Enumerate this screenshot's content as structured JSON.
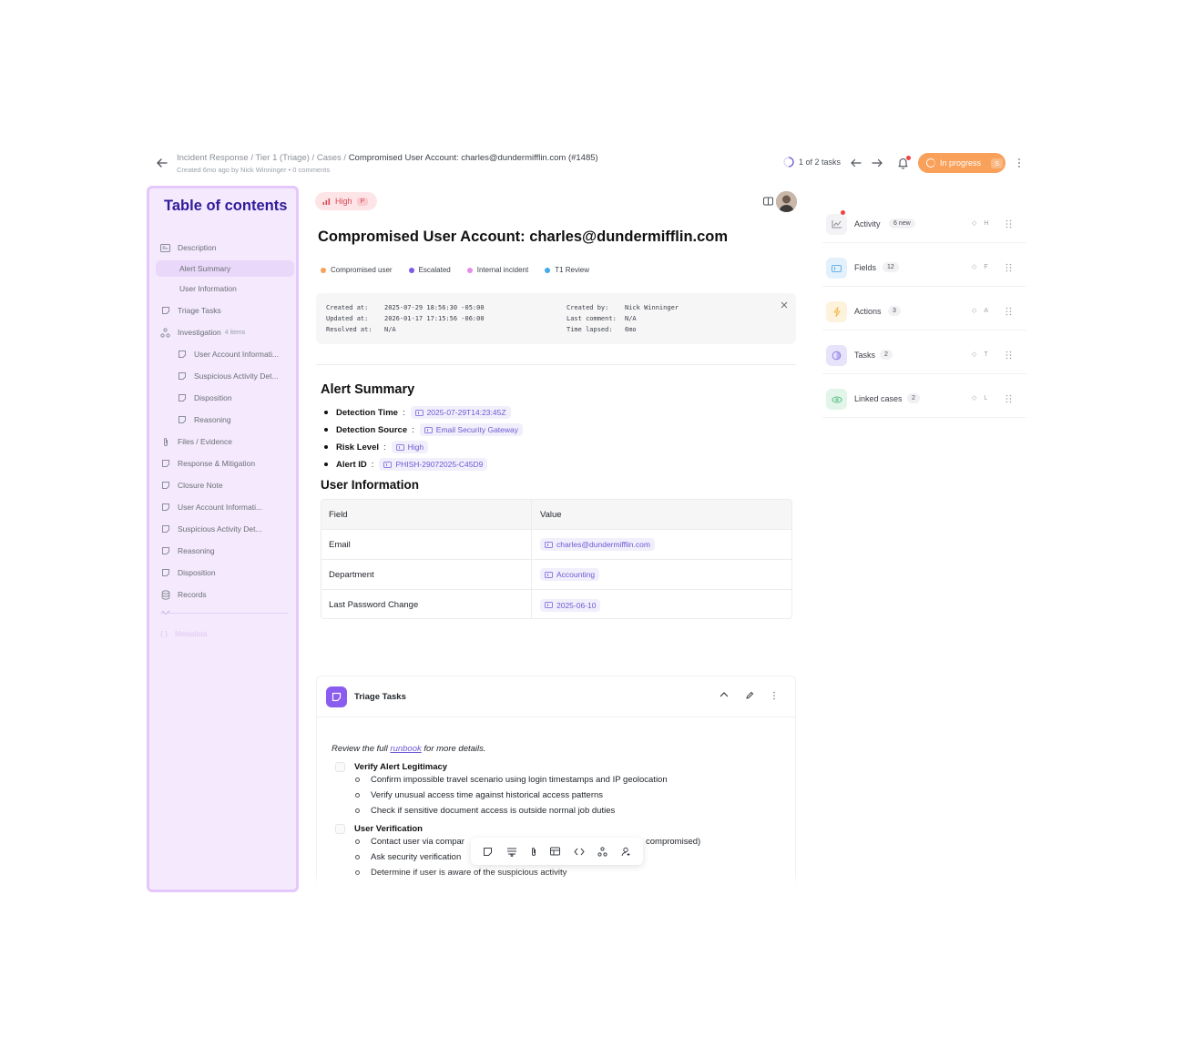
{
  "header": {
    "breadcrumb_path": "Incident Response / Tier 1 (Triage) / Cases / ",
    "breadcrumb_current": "Compromised User Account: charles@dundermifflin.com (#1485)",
    "subline": "Created 6mo ago by Nick Winninger • 0 comments",
    "task_progress": "1 of 2 tasks",
    "status_label": "In progress",
    "status_key": "S"
  },
  "toc": {
    "title": "Table of contents",
    "items": [
      {
        "label": "Description",
        "icon": "description-icon"
      },
      {
        "label": "Alert Summary"
      },
      {
        "label": "User Information"
      },
      {
        "label": "Triage Tasks",
        "icon": "note-icon"
      },
      {
        "label": "Investigation",
        "count": "4 items",
        "icon": "workflow-icon"
      },
      {
        "label": "User Account Informati...",
        "icon": "note-icon"
      },
      {
        "label": "Suspicious Activity Det...",
        "icon": "note-icon"
      },
      {
        "label": "Disposition",
        "icon": "note-icon"
      },
      {
        "label": "Reasoning",
        "icon": "note-icon"
      },
      {
        "label": "Files / Evidence",
        "icon": "paperclip-icon"
      },
      {
        "label": "Response & Mitigation",
        "icon": "note-icon"
      },
      {
        "label": "Closure Note",
        "icon": "note-icon"
      },
      {
        "label": "User Account Informati...",
        "icon": "note-icon"
      },
      {
        "label": "Suspicious Activity Det...",
        "icon": "note-icon"
      },
      {
        "label": "Reasoning",
        "icon": "note-icon"
      },
      {
        "label": "Disposition",
        "icon": "note-icon"
      },
      {
        "label": "Records",
        "icon": "database-icon"
      }
    ],
    "metadata_label": "Metadata"
  },
  "case": {
    "priority_label": "High",
    "priority_key": "P",
    "title": "Compromised User Account: charles@dundermifflin.com",
    "tags": [
      {
        "label": "Compromised user",
        "color": "#f4a259"
      },
      {
        "label": "Escalated",
        "color": "#7c5ce6"
      },
      {
        "label": "Internal incident",
        "color": "#e58ee8"
      },
      {
        "label": "T1 Review",
        "color": "#45a8e8"
      }
    ],
    "meta": {
      "created_at_label": "Created at:",
      "created_at": "2025-07-29 18:56:30 -05:00",
      "updated_at_label": "Updated at:",
      "updated_at": "2026-01-17 17:15:56 -06:00",
      "resolved_at_label": "Resolved at:",
      "resolved_at": "N/A",
      "created_by_label": "Created by:",
      "created_by": "Nick Winninger",
      "last_comment_label": "Last comment:",
      "last_comment": "N/A",
      "time_lapsed_label": "Time lapsed:",
      "time_lapsed": "6mo"
    }
  },
  "alert_summary": {
    "heading": "Alert Summary",
    "items": [
      {
        "label": "Detection Time",
        "value": "2025-07-29T14:23:45Z"
      },
      {
        "label": "Detection Source",
        "value": "Email Security Gateway"
      },
      {
        "label": "Risk Level",
        "value": "High"
      },
      {
        "label": "Alert ID",
        "value": "PHISH-29072025-C45D9"
      }
    ]
  },
  "user_information": {
    "heading": "User Information",
    "columns": [
      "Field",
      "Value"
    ],
    "rows": [
      {
        "field": "Email",
        "value": "charles@dundermifflin.com"
      },
      {
        "field": "Department",
        "value": "Accounting"
      },
      {
        "field": "Last Password Change",
        "value": "2025-06-10"
      }
    ]
  },
  "triage": {
    "title": "Triage Tasks",
    "runbook_prefix": "Review the full ",
    "runbook_link": "runbook",
    "runbook_suffix": " for more details.",
    "groups": [
      {
        "title": "Verify Alert Legitimacy",
        "items": [
          "Confirm impossible travel scenario using login timestamps and IP geolocation",
          "Verify unusual access time against historical access patterns",
          "Check if sensitive document access is outside normal job duties"
        ]
      },
      {
        "title": "User Verification",
        "items": [
          "Contact user via compar",
          "Ask security verification",
          "Determine if user is aware of the suspicious activity"
        ],
        "item_tail": "compromised)"
      }
    ]
  },
  "right_panel": {
    "rows": [
      {
        "label": "Activity",
        "count": "6 new",
        "key": "H",
        "icon": "chart-icon"
      },
      {
        "label": "Fields",
        "count": "12",
        "key": "F",
        "icon": "fields-icon"
      },
      {
        "label": "Actions",
        "count": "3",
        "key": "A",
        "icon": "bolt-icon"
      },
      {
        "label": "Tasks",
        "count": "2",
        "key": "T",
        "icon": "tasks-icon"
      },
      {
        "label": "Linked cases",
        "count": "2",
        "key": "L",
        "icon": "link-icon"
      }
    ]
  }
}
